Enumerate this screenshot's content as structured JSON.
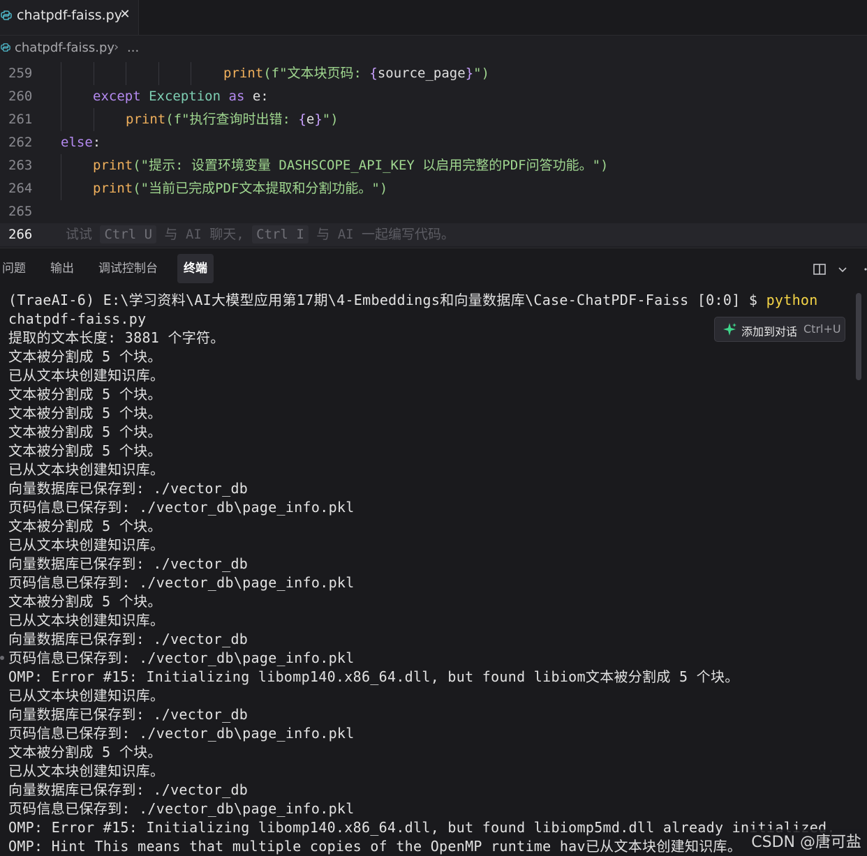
{
  "tab": {
    "filename": "chatpdf-faiss.py",
    "close_glyph": "✕"
  },
  "breadcrumb": {
    "file": "chatpdf-faiss.py",
    "separator": "›",
    "more": "..."
  },
  "editor": {
    "lines": [
      {
        "num": "259",
        "fn": "print",
        "p1": "(f\"文本块页码: ",
        "b1": "{",
        "v": "source_page",
        "b2": "}",
        "p2": "\")"
      },
      {
        "num": "260",
        "kw": "except",
        "cls": "Exception",
        "kw2": "as",
        "v": "e",
        "colon": ":"
      },
      {
        "num": "261",
        "fn": "print",
        "p1": "(f\"执行查询时出错: ",
        "b1": "{",
        "v": "e",
        "b2": "}",
        "p2": "\")"
      },
      {
        "num": "262",
        "kw": "else",
        "colon": ":"
      },
      {
        "num": "263",
        "fn": "print",
        "s": "(\"提示: 设置环境变量 DASHSCOPE_API_KEY 以启用完整的PDF问答功能。\")"
      },
      {
        "num": "264",
        "fn": "print",
        "s": "(\"当前已完成PDF文本提取和分割功能。\")"
      },
      {
        "num": "265"
      },
      {
        "num": "266",
        "h1": "试试 ",
        "k1": "Ctrl U",
        "h2": " 与 AI 聊天, ",
        "k2": "Ctrl I",
        "h3": " 与 AI 一起编写代码。"
      }
    ]
  },
  "panel": {
    "tabs": [
      "问题",
      "输出",
      "调试控制台",
      "终端"
    ],
    "active_tab": "终端"
  },
  "terminal": {
    "prompt": "(TraeAI-6) E:\\学习资料\\AI大模型应用第17期\\4-Embeddings和向量数据库\\Case-ChatPDF-Faiss [0:0] $ ",
    "command": "python",
    "lines": [
      "chatpdf-faiss.py",
      "提取的文本长度: 3881 个字符。",
      "文本被分割成 5 个块。",
      "已从文本块创建知识库。",
      "文本被分割成 5 个块。",
      "文本被分割成 5 个块。",
      "文本被分割成 5 个块。",
      "文本被分割成 5 个块。",
      "已从文本块创建知识库。",
      "向量数据库已保存到: ./vector_db",
      "页码信息已保存到: ./vector_db\\page_info.pkl",
      "文本被分割成 5 个块。",
      "已从文本块创建知识库。",
      "向量数据库已保存到: ./vector_db",
      "页码信息已保存到: ./vector_db\\page_info.pkl",
      "文本被分割成 5 个块。",
      "已从文本块创建知识库。",
      "向量数据库已保存到: ./vector_db",
      "页码信息已保存到: ./vector_db\\page_info.pkl",
      "OMP: Error #15: Initializing libomp140.x86_64.dll, but found libiom文本被分割成 5 个块。",
      "已从文本块创建知识库。",
      "向量数据库已保存到: ./vector_db",
      "页码信息已保存到: ./vector_db\\page_info.pkl",
      "文本被分割成 5 个块。",
      "已从文本块创建知识库。",
      "向量数据库已保存到: ./vector_db",
      "页码信息已保存到: ./vector_db\\page_info.pkl",
      "OMP: Error #15: Initializing libomp140.x86_64.dll, but found libiomp5md.dll already initialized.",
      "OMP: Hint This means that multiple copies of the OpenMP runtime hav已从文本块创建知识库。"
    ],
    "add_to_chat": {
      "label": "添加到对话",
      "shortcut": "Ctrl+U"
    }
  },
  "watermark": "CSDN @唐可盐"
}
